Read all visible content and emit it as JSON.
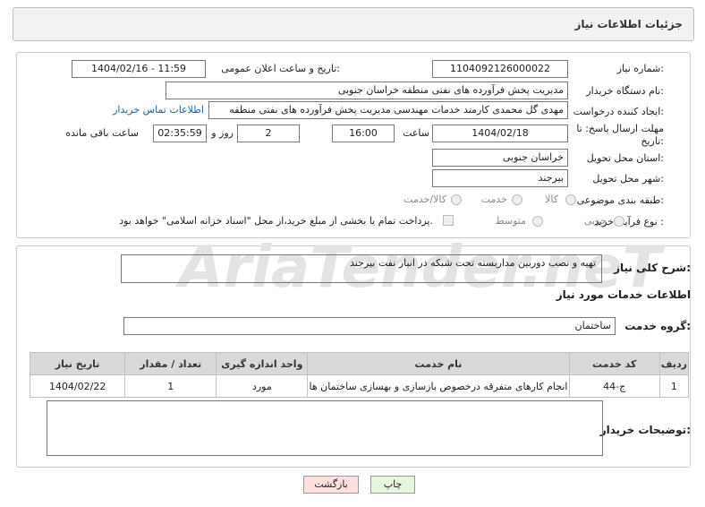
{
  "page_title": "جزئیات اطلاعات نیاز",
  "fields": {
    "need_number_label": "شماره نیاز:",
    "need_number": "1104092126000022",
    "announce_label": "تاریخ و ساعت اعلان عمومی:",
    "announce_value": "1404/02/16 - 11:59",
    "buyer_org_label": "نام دستگاه خریدار:",
    "buyer_org": "مدیریت پخش فرآورده های نفتی منطقه خراسان جنوبی",
    "creator_label": "ایجاد کننده درخواست:",
    "creator": "مهدی گل محمدی کارمند خدمات مهندسی مدیریت پخش فرآورده های نفتی منطقه",
    "contact_link": "اطلاعات تماس خریدار",
    "deadline_label_1": "مهلت ارسال پاسخ: تا",
    "deadline_label_2": "تاریخ:",
    "deadline_date": "1404/02/18",
    "time_label": "ساعت",
    "deadline_time": "16:00",
    "days_value": "2",
    "days_label": "روز و",
    "remaining_time": "02:35:59",
    "remaining_label": "ساعت باقی مانده",
    "province_label": "استان محل تحویل:",
    "province": "خراسان جنوبی",
    "city_label": "شهر محل تحویل:",
    "city": "بیرجند",
    "category_label": "طبقه بندی موضوعی:",
    "category_options": [
      "کالا",
      "خدمت",
      "کالا/خدمت"
    ],
    "process_label": "نوع فرآیند خرید :",
    "process_options": [
      "جزیی",
      "متوسط"
    ],
    "payment_note": "پرداخت تمام یا بخشی از مبلغ خرید،از محل \"اسناد خزانه اسلامی\" خواهد بود."
  },
  "summary": {
    "label": "شرح کلی نیاز:",
    "text": "تهیه و نصب دوربین مداربسته تحت شبکه در انبار نفت بیرجند"
  },
  "services_heading": "اطلاعات خدمات مورد نیاز",
  "service_group": {
    "label": "گروه خدمت:",
    "value": "ساختمان"
  },
  "table": {
    "headers": [
      "ردیف",
      "کد خدمت",
      "نام خدمت",
      "واحد اندازه گیری",
      "تعداد / مقدار",
      "تاریخ نیاز"
    ],
    "rows": [
      [
        "1",
        "ج-44",
        "انجام کارهای متفرقه درخصوص بازسازی و بهسازی ساختمان ها",
        "مورد",
        "1",
        "1404/02/22"
      ]
    ]
  },
  "buyer_notes_label": "توضیحات خریدار:",
  "buttons": {
    "print": "چاپ",
    "back": "بازگشت"
  },
  "watermark": "AriaTender.neT",
  "colors": {
    "link": "#1a5fb4",
    "back_button_bg": "#fde0e0",
    "print_button_bg": "#e8f6e0"
  }
}
